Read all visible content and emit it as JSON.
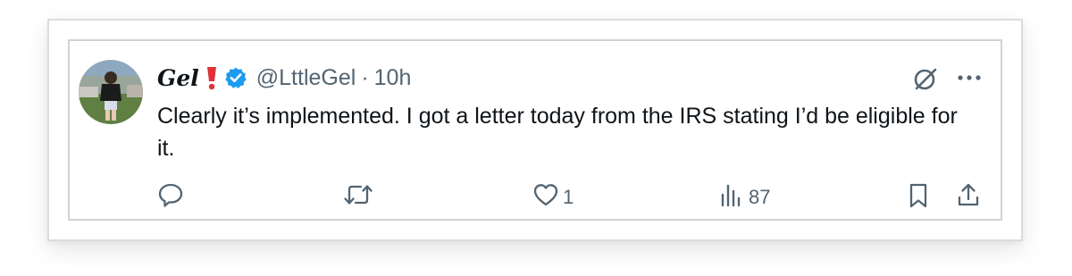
{
  "tweet": {
    "display_name": "Gel",
    "handle": "@LttleGel",
    "separator": "·",
    "time": "10h",
    "text": "Clearly it’s implemented. I got a letter today from the IRS stating I’d be eligible for it."
  },
  "actions": {
    "reply_count": "",
    "retweet_count": "",
    "like_count": "1",
    "views_count": "87"
  },
  "icons": {
    "avatar": "avatar-photo",
    "emoji": "exclamation-icon",
    "verified": "verified-badge-icon",
    "grok": "grok-icon",
    "more": "more-icon",
    "reply": "reply-icon",
    "retweet": "retweet-icon",
    "like": "heart-icon",
    "views": "views-icon",
    "bookmark": "bookmark-icon",
    "share": "share-icon"
  },
  "colors": {
    "verified": "#1d9bf0",
    "text": "#0f1419",
    "muted": "#536471",
    "emoji": "#e0303a"
  }
}
